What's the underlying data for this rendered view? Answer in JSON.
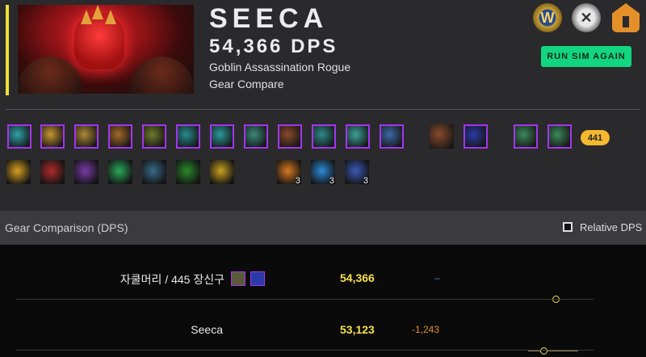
{
  "header": {
    "name": "SEECA",
    "dps": "54,366 DPS",
    "spec": "Goblin Assassination Rogue",
    "mode": "Gear Compare",
    "run_button": "RUN SIM AGAIN",
    "icons": [
      "wow-armory-icon",
      "raiderio-icon",
      "warcraftlogs-icon"
    ],
    "accent_color": "#f0e033"
  },
  "gear": {
    "row1": [
      {
        "icon": "head-icon",
        "quality": "epic",
        "color": "#2fa3a8"
      },
      {
        "icon": "neck-icon",
        "quality": "epic",
        "color": "#c7952e"
      },
      {
        "icon": "shoulder-icon",
        "quality": "epic",
        "color": "#b08a36"
      },
      {
        "icon": "back-icon",
        "quality": "epic",
        "color": "#a56a2a"
      },
      {
        "icon": "chest-icon",
        "quality": "epic",
        "color": "#6e7a2a"
      },
      {
        "icon": "wrist-icon",
        "quality": "epic",
        "color": "#278c8c"
      },
      {
        "icon": "hands-icon",
        "quality": "epic",
        "color": "#2a9a9a"
      },
      {
        "icon": "waist-icon",
        "quality": "epic",
        "color": "#3a8a7a"
      },
      {
        "icon": "legs-icon",
        "quality": "epic",
        "color": "#8a4a2a"
      },
      {
        "icon": "feet-icon",
        "quality": "epic",
        "color": "#2e8a8a"
      },
      {
        "icon": "ring-icon",
        "quality": "epic",
        "color": "#3aa39a"
      },
      {
        "icon": "ring-icon",
        "quality": "epic",
        "color": "#3c6aa8"
      },
      {
        "icon": "trinket-icon",
        "quality": "none",
        "color": "#8a4a2a"
      },
      {
        "icon": "trinket-icon",
        "quality": "epic",
        "color": "#2a3aa8"
      },
      {
        "icon": "main-hand-icon",
        "quality": "epic",
        "color": "#3a8a5a"
      },
      {
        "icon": "off-hand-icon",
        "quality": "epic",
        "color": "#3a8a5a"
      }
    ],
    "item_level": "441",
    "row2": [
      {
        "icon": "talent-icon",
        "color": "#d8a020"
      },
      {
        "icon": "talent-icon",
        "color": "#b02a2a"
      },
      {
        "icon": "talent-icon",
        "color": "#7a3aa8"
      },
      {
        "icon": "talent-icon",
        "color": "#2aa85a"
      },
      {
        "icon": "talent-icon",
        "color": "#3a6a8a"
      },
      {
        "icon": "talent-icon",
        "color": "#2a8a2a"
      },
      {
        "icon": "talent-icon",
        "color": "#c8a020"
      }
    ],
    "row3": [
      {
        "icon": "gem-icon",
        "color": "#d87a20",
        "count": "3"
      },
      {
        "icon": "gem-icon",
        "color": "#2a8ad8",
        "count": "3"
      },
      {
        "icon": "gem-icon",
        "color": "#3a5ab8",
        "count": "3"
      }
    ]
  },
  "comparison": {
    "title": "Gear Comparison (DPS)",
    "relative_label": "Relative DPS",
    "rows": [
      {
        "label": "자쿨머리 / 445 장신구",
        "dps": "54,366",
        "diff": "–",
        "diff_color": "#3a8ad8",
        "position": 0.45
      },
      {
        "label": "Seeca",
        "dps": "53,123",
        "diff": "-1,243",
        "diff_color": "#e0902a",
        "position": 0.12
      }
    ]
  }
}
